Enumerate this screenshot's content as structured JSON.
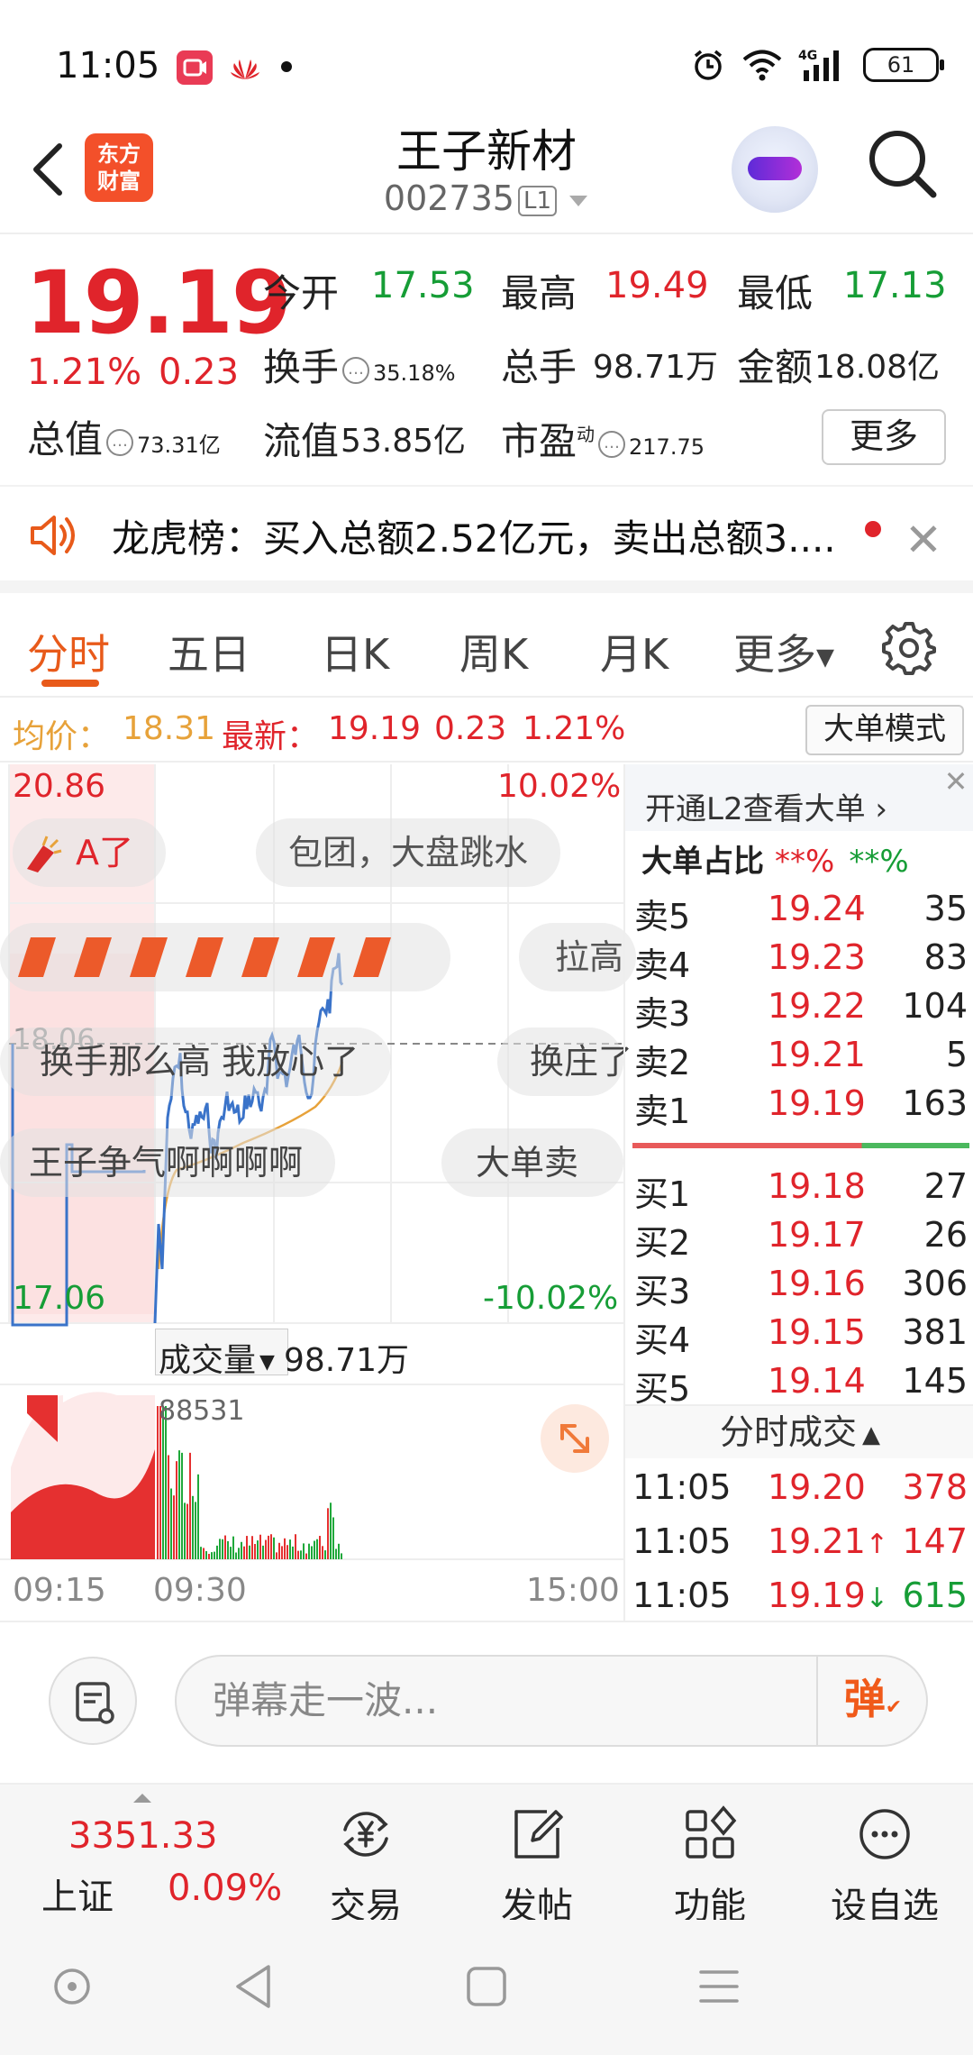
{
  "status_bar": {
    "time": "11:05",
    "network": "4G",
    "battery": "61",
    "icons": [
      "video-app-icon",
      "huawei-logo-icon",
      "notification-dot",
      "alarm-icon",
      "wifi-icon",
      "signal-icon",
      "battery-icon"
    ]
  },
  "header": {
    "logo_line1": "东方",
    "logo_line2": "财富",
    "stock_name": "王子新材",
    "stock_code": "002735",
    "level_badge": "L1"
  },
  "quote": {
    "price": "19.19",
    "change_pct": "1.21%",
    "change_amt": "0.23",
    "open_label": "今开",
    "open": "17.53",
    "high_label": "最高",
    "high": "19.49",
    "low_label": "最低",
    "low": "17.13",
    "turnover_label": "换手",
    "turnover": "35.18%",
    "volume_label": "总手",
    "volume": "98.71万",
    "amount_label": "金额",
    "amount": "18.08亿",
    "mktcap_label": "总值",
    "mktcap": "73.31亿",
    "float_label": "流值",
    "float": "53.85亿",
    "pe_label": "市盈",
    "pe_sup": "动",
    "pe": "217.75",
    "more_label": "更多",
    "colors": {
      "up": "#e0242b",
      "down": "#169d36"
    }
  },
  "news": {
    "text": "龙虎榜：买入总额2.52亿元，卖出总额3...."
  },
  "tabs": {
    "items": [
      "分时",
      "五日",
      "日K",
      "周K",
      "月K",
      "更多"
    ],
    "active": "分时"
  },
  "avg_row": {
    "avg_label": "均价：",
    "avg_value": "18.31",
    "latest_label": "最新：",
    "latest_value": "19.19",
    "latest_chg": "0.23",
    "latest_pct": "1.21%",
    "mode_button": "大单模式"
  },
  "chart": {
    "y_top": "20.86",
    "y_top_pct": "10.02%",
    "y_mid": "18.06",
    "y_bottom": "17.06",
    "y_bottom_pct": "-10.02%",
    "volume_selector": "成交量",
    "volume_total": "98.71万",
    "volume_max": "88531",
    "time_labels": [
      "09:15",
      "09:30",
      "15:00"
    ],
    "danmu": [
      "A了",
      "包团，大盘跳水",
      "拉高",
      "换手那么高 我放心了",
      "换庄了",
      "王子争气啊啊啊啊",
      "大单卖"
    ]
  },
  "book": {
    "l2_banner": "开通L2查看大单",
    "big_ratio_label": "大单占比",
    "big_ratio_buy": "**%",
    "big_ratio_sell": "**%",
    "asks": [
      {
        "label": "卖5",
        "price": "19.24",
        "vol": "35"
      },
      {
        "label": "卖4",
        "price": "19.23",
        "vol": "83"
      },
      {
        "label": "卖3",
        "price": "19.22",
        "vol": "104"
      },
      {
        "label": "卖2",
        "price": "19.21",
        "vol": "5"
      },
      {
        "label": "卖1",
        "price": "19.19",
        "vol": "163"
      }
    ],
    "bids": [
      {
        "label": "买1",
        "price": "19.18",
        "vol": "27"
      },
      {
        "label": "买2",
        "price": "19.17",
        "vol": "26"
      },
      {
        "label": "买3",
        "price": "19.16",
        "vol": "306"
      },
      {
        "label": "买4",
        "price": "19.15",
        "vol": "381"
      },
      {
        "label": "买5",
        "price": "19.14",
        "vol": "145"
      }
    ],
    "ticks_title": "分时成交",
    "ticks": [
      {
        "time": "11:05",
        "price": "19.20",
        "vol": "378",
        "dir": ""
      },
      {
        "time": "11:05",
        "price": "19.21",
        "vol": "147",
        "dir": "↑"
      },
      {
        "time": "11:05",
        "price": "19.19",
        "vol": "615",
        "dir": "↓"
      }
    ]
  },
  "comment": {
    "placeholder": "弹幕走一波...",
    "send_label": "弹"
  },
  "bottom_nav": {
    "index_value": "3351.33",
    "index_name": "上证",
    "index_pct": "0.09%",
    "items": [
      "交易",
      "发帖",
      "功能",
      "设自选"
    ]
  }
}
